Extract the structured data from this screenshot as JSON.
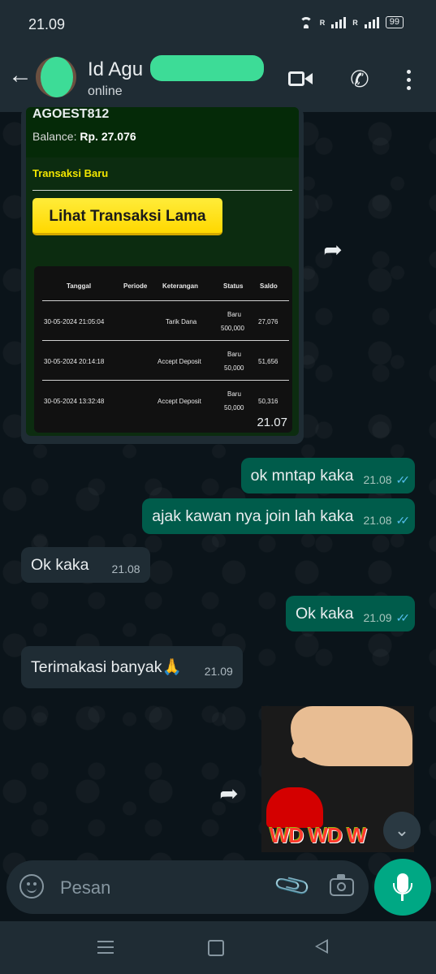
{
  "status_bar": {
    "time": "21.09",
    "battery": "99",
    "signal_label": "R"
  },
  "contact": {
    "name": "Id Agu",
    "status": "online"
  },
  "image_message": {
    "username": "AGOEST812",
    "balance_label": "Balance:",
    "balance_value": "Rp. 27.076",
    "section_title": "Transaksi Baru",
    "button_label": "Lihat Transaksi Lama",
    "table": {
      "headers": [
        "Tanggal",
        "Periode",
        "Keterangan",
        "Status",
        "Saldo"
      ],
      "rows": [
        {
          "tanggal": "30-05-2024 21:05:04",
          "keterangan": "Tarik Dana",
          "status": "Baru",
          "amount": "500,000",
          "saldo": "27,076"
        },
        {
          "tanggal": "30-05-2024 20:14:18",
          "keterangan": "Accept Deposit",
          "status": "Baru",
          "amount": "50,000",
          "saldo": "51,656"
        },
        {
          "tanggal": "30-05-2024 13:32:48",
          "keterangan": "Accept Deposit",
          "status": "Baru",
          "amount": "50,000",
          "saldo": "50,316"
        }
      ]
    },
    "time": "21.07"
  },
  "messages": [
    {
      "text": "ok mntap kaka",
      "time": "21.08",
      "direction": "out"
    },
    {
      "text": "ajak kawan nya join lah kaka",
      "time": "21.08",
      "direction": "out"
    },
    {
      "text": "Ok kaka",
      "time": "21.08",
      "direction": "in"
    },
    {
      "text": "Ok kaka",
      "time": "21.09",
      "direction": "out"
    },
    {
      "text": "Terimakasi banyak🙏",
      "time": "21.09",
      "direction": "in"
    }
  ],
  "sticker": {
    "text": "WD WD W"
  },
  "input": {
    "placeholder": "Pesan"
  },
  "colors": {
    "outgoing_bubble": "#005c4b",
    "incoming_bubble": "#1f2c34",
    "accent": "#00a884",
    "read_ticks": "#53bdeb"
  },
  "icons": {
    "back": "arrow-left-icon",
    "video": "video-call-icon",
    "phone": "phone-icon",
    "menu": "more-vertical-icon",
    "forward": "forward-icon",
    "emoji": "emoji-icon",
    "attach": "paperclip-icon",
    "camera": "camera-icon",
    "mic": "mic-icon",
    "scroll": "double-chevron-down-icon"
  }
}
